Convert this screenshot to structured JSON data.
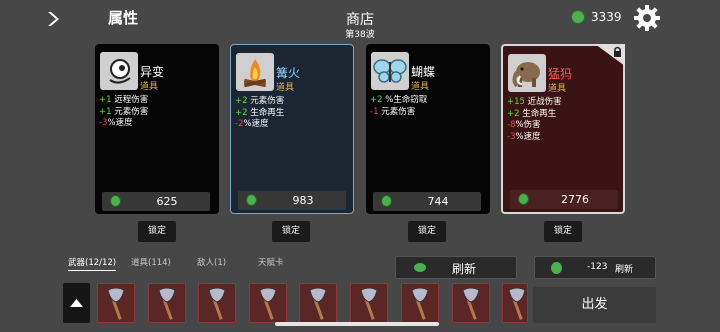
{
  "header": {
    "attributes": "属性",
    "shop": "商店",
    "wave": "第38波",
    "money": "3339"
  },
  "cards": [
    {
      "name": "异变",
      "type": "道具",
      "name_color": "#ffffff",
      "price": "625",
      "stats": [
        [
          "+1",
          "远程伤害",
          "g"
        ],
        [
          "+1",
          "元素伤害",
          "g"
        ],
        [
          "-3",
          "%速度",
          "r"
        ]
      ]
    },
    {
      "name": "篝火",
      "type": "道具",
      "name_color": "#8fd0ff",
      "price": "983",
      "stats": [
        [
          "+2",
          "元素伤害",
          "g"
        ],
        [
          "+2",
          "生命再生",
          "g"
        ],
        [
          "-2",
          "%速度",
          "r"
        ]
      ]
    },
    {
      "name": "蝴蝶",
      "type": "道具",
      "name_color": "#ffffff",
      "price": "744",
      "stats": [
        [
          "+2",
          "%生命窃取",
          "g"
        ],
        [
          "-1",
          "元素伤害",
          "r"
        ]
      ]
    },
    {
      "name": "猛犸",
      "type": "道具",
      "name_color": "#ff5a5a",
      "price": "2776",
      "stats": [
        [
          "+15",
          "近战伤害",
          "g"
        ],
        [
          "+2",
          "生命再生",
          "g"
        ],
        [
          "-8",
          "%伤害",
          "r"
        ],
        [
          "-3",
          "%速度",
          "r"
        ]
      ]
    }
  ],
  "lock_label": "锁定",
  "tabs": [
    "武器(12/12)",
    "道具(114)",
    "敌人(1)",
    "天赋卡"
  ],
  "refresh_label": "刷新",
  "refresh_cost": "-123",
  "go_label": "出发",
  "colors": {
    "accent_green": "#4caf50",
    "rare_red": "#ff5a5a",
    "rare_blue": "#8fd0ff"
  }
}
